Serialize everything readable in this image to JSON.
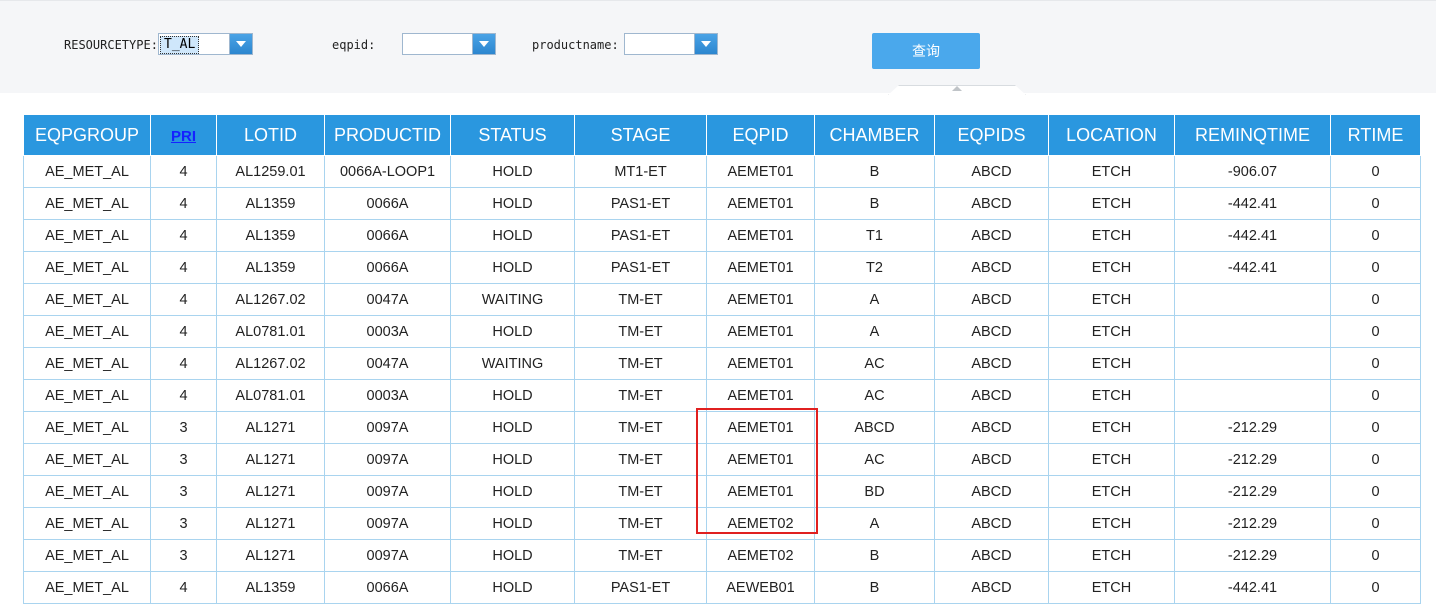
{
  "filters": {
    "resourcetype": {
      "label": "RESOURCETYPE:",
      "value": "T_AL"
    },
    "eqpid": {
      "label": "eqpid:",
      "value": ""
    },
    "productname": {
      "label": "productname:",
      "value": ""
    },
    "query_label": "查询"
  },
  "grid": {
    "columns": [
      "EQPGROUP",
      "PRI",
      "LOTID",
      "PRODUCTID",
      "STATUS",
      "STAGE",
      "EQPID",
      "CHAMBER",
      "EQPIDS",
      "LOCATION",
      "REMINQTIME",
      "RTIME"
    ],
    "rows": [
      [
        "AE_MET_AL",
        "4",
        "AL1259.01",
        "0066A-LOOP1",
        "HOLD",
        "MT1-ET",
        "AEMET01",
        "B",
        "ABCD",
        "ETCH",
        "-906.07",
        "0"
      ],
      [
        "AE_MET_AL",
        "4",
        "AL1359",
        "0066A",
        "HOLD",
        "PAS1-ET",
        "AEMET01",
        "B",
        "ABCD",
        "ETCH",
        "-442.41",
        "0"
      ],
      [
        "AE_MET_AL",
        "4",
        "AL1359",
        "0066A",
        "HOLD",
        "PAS1-ET",
        "AEMET01",
        "T1",
        "ABCD",
        "ETCH",
        "-442.41",
        "0"
      ],
      [
        "AE_MET_AL",
        "4",
        "AL1359",
        "0066A",
        "HOLD",
        "PAS1-ET",
        "AEMET01",
        "T2",
        "ABCD",
        "ETCH",
        "-442.41",
        "0"
      ],
      [
        "AE_MET_AL",
        "4",
        "AL1267.02",
        "0047A",
        "WAITING",
        "TM-ET",
        "AEMET01",
        "A",
        "ABCD",
        "ETCH",
        "",
        "0"
      ],
      [
        "AE_MET_AL",
        "4",
        "AL0781.01",
        "0003A",
        "HOLD",
        "TM-ET",
        "AEMET01",
        "A",
        "ABCD",
        "ETCH",
        "",
        "0"
      ],
      [
        "AE_MET_AL",
        "4",
        "AL1267.02",
        "0047A",
        "WAITING",
        "TM-ET",
        "AEMET01",
        "AC",
        "ABCD",
        "ETCH",
        "",
        "0"
      ],
      [
        "AE_MET_AL",
        "4",
        "AL0781.01",
        "0003A",
        "HOLD",
        "TM-ET",
        "AEMET01",
        "AC",
        "ABCD",
        "ETCH",
        "",
        "0"
      ],
      [
        "AE_MET_AL",
        "3",
        "AL1271",
        "0097A",
        "HOLD",
        "TM-ET",
        "AEMET01",
        "ABCD",
        "ABCD",
        "ETCH",
        "-212.29",
        "0"
      ],
      [
        "AE_MET_AL",
        "3",
        "AL1271",
        "0097A",
        "HOLD",
        "TM-ET",
        "AEMET01",
        "AC",
        "ABCD",
        "ETCH",
        "-212.29",
        "0"
      ],
      [
        "AE_MET_AL",
        "3",
        "AL1271",
        "0097A",
        "HOLD",
        "TM-ET",
        "AEMET01",
        "BD",
        "ABCD",
        "ETCH",
        "-212.29",
        "0"
      ],
      [
        "AE_MET_AL",
        "3",
        "AL1271",
        "0097A",
        "HOLD",
        "TM-ET",
        "AEMET02",
        "A",
        "ABCD",
        "ETCH",
        "-212.29",
        "0"
      ],
      [
        "AE_MET_AL",
        "3",
        "AL1271",
        "0097A",
        "HOLD",
        "TM-ET",
        "AEMET02",
        "B",
        "ABCD",
        "ETCH",
        "-212.29",
        "0"
      ],
      [
        "AE_MET_AL",
        "4",
        "AL1359",
        "0066A",
        "HOLD",
        "PAS1-ET",
        "AEWEB01",
        "B",
        "ABCD",
        "ETCH",
        "-442.41",
        "0"
      ]
    ]
  }
}
